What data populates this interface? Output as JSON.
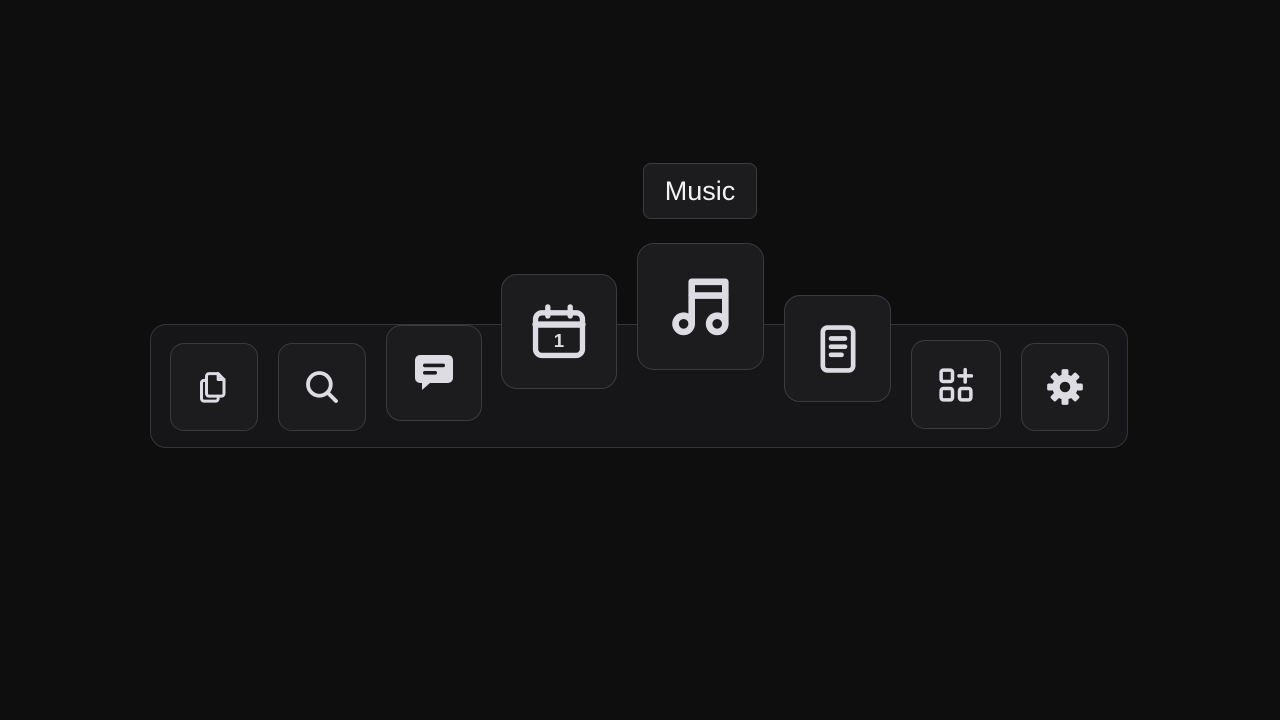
{
  "tooltip": {
    "label": "Music"
  },
  "dock": {
    "items": [
      {
        "id": "copy",
        "icon": "copy-icon"
      },
      {
        "id": "search",
        "icon": "search-icon"
      },
      {
        "id": "messages",
        "icon": "message-icon"
      },
      {
        "id": "calendar",
        "icon": "calendar-icon",
        "day": "1"
      },
      {
        "id": "music",
        "icon": "music-note-icon"
      },
      {
        "id": "notes",
        "icon": "document-icon"
      },
      {
        "id": "apps",
        "icon": "apps-add-icon"
      },
      {
        "id": "settings",
        "icon": "gear-icon"
      }
    ]
  },
  "colors": {
    "background": "#0e0e0f",
    "dock": "#161618",
    "tile": "#1c1c1f",
    "border": "#3a3a40",
    "icon": "#dcdce2"
  }
}
